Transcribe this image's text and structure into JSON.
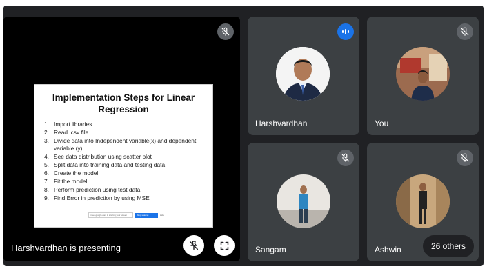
{
  "presentation": {
    "label": "Harshvardhan is presenting",
    "slide_title": "Implementation Steps for Linear Regression",
    "steps": [
      {
        "num": "1.",
        "text": "Import libraries"
      },
      {
        "num": "2.",
        "text": "Read .csv file"
      },
      {
        "num": "3.",
        "text": "Divide data into Independent variable(x) and dependent variable (y)"
      },
      {
        "num": "4.",
        "text": "See data distribution using scatter plot"
      },
      {
        "num": "5.",
        "text": "Split data into training data and testing data"
      },
      {
        "num": "6.",
        "text": "Create the model"
      },
      {
        "num": "7.",
        "text": "Fit the model"
      },
      {
        "num": "8.",
        "text": "Perform prediction using test data"
      },
      {
        "num": "9.",
        "text": "Find Error in prediction by using MSE"
      }
    ],
    "share_bar": {
      "text": "meet.google.com is sharing your screen",
      "stop": "Stop sharing",
      "hide": "Hide"
    }
  },
  "participants": [
    {
      "name": "Harshvardhan",
      "status": "speaking"
    },
    {
      "name": "You",
      "status": "muted"
    },
    {
      "name": "Sangam",
      "status": "muted"
    },
    {
      "name": "Ashwin",
      "status": "muted"
    }
  ],
  "others_label": "26 others",
  "colors": {
    "background": "#202124",
    "tile": "#3c4043",
    "accent": "#1a73e8"
  },
  "icons": {
    "mic_off": "mic-off-icon",
    "speaking": "audio-level-icon",
    "unpin": "unpin-icon",
    "fullscreen": "fullscreen-icon"
  }
}
